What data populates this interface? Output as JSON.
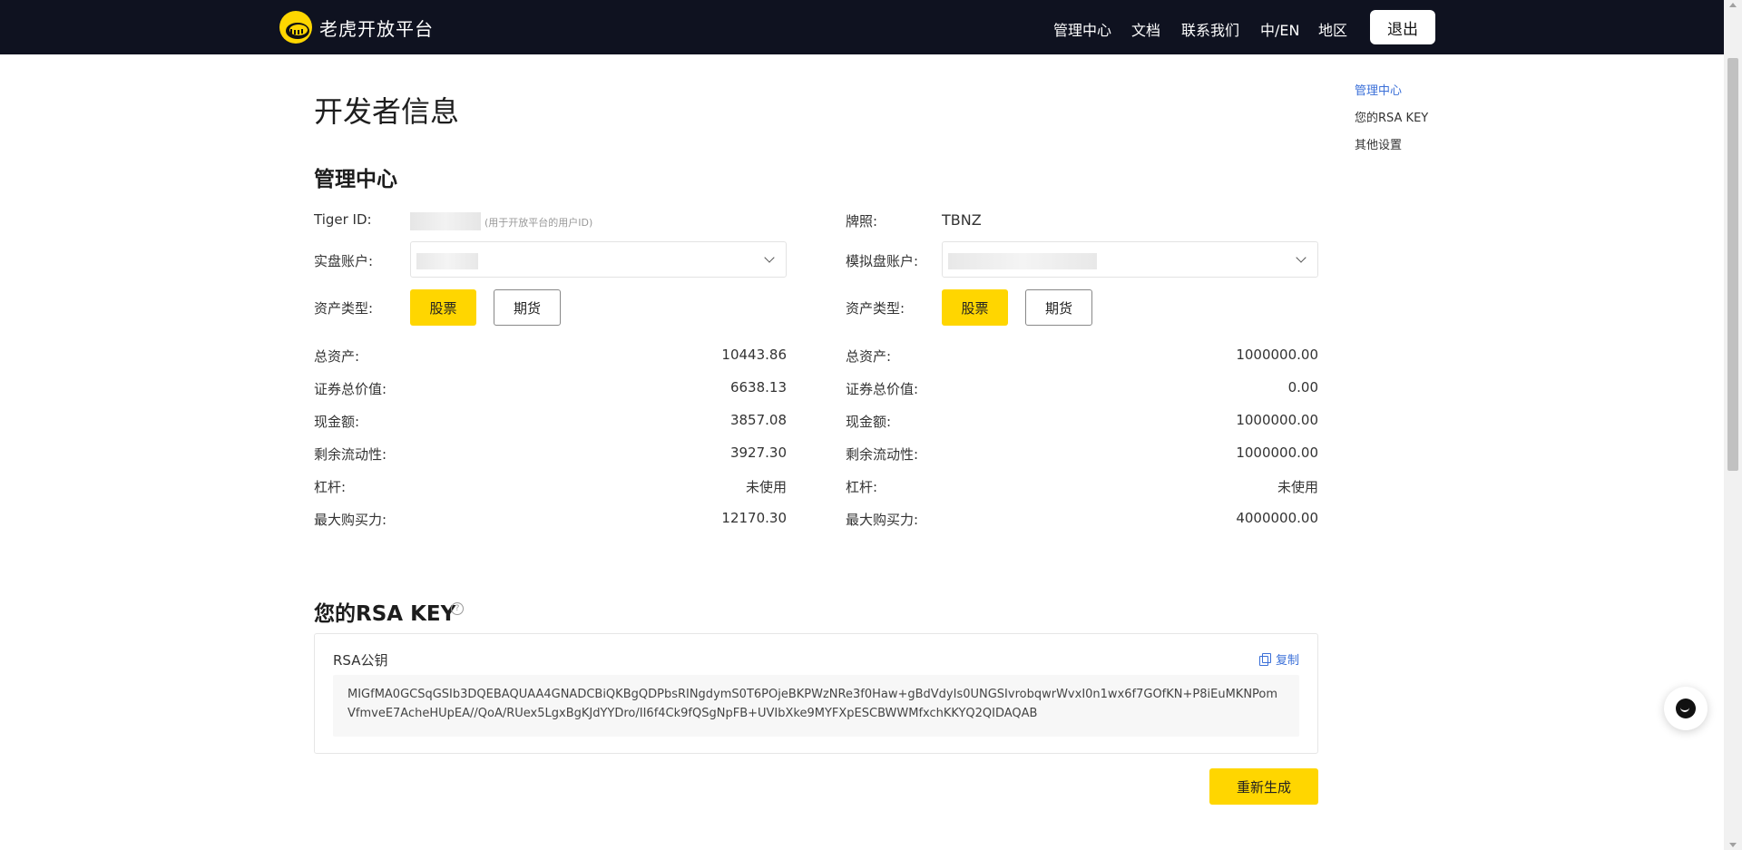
{
  "brand": {
    "name": "老虎开放平台",
    "color": "#ffd600"
  },
  "nav": {
    "items": [
      "管理中心",
      "文档",
      "联系我们",
      "中/EN",
      "地区"
    ],
    "logout": "退出"
  },
  "page": {
    "title": "开发者信息",
    "section_title": "管理中心"
  },
  "left": {
    "tiger_id_label": "Tiger ID:",
    "tiger_id_hint": "(用于开放平台的用户ID)",
    "account_label": "实盘账户:",
    "asset_type_label": "资产类型:",
    "btn_stock": "股票",
    "btn_futures": "期货",
    "rows": [
      {
        "label": "总资产:",
        "value": "10443.86"
      },
      {
        "label": "证券总价值:",
        "value": "6638.13"
      },
      {
        "label": "现金额:",
        "value": "3857.08"
      },
      {
        "label": "剩余流动性:",
        "value": "3927.30"
      },
      {
        "label": "杠杆:",
        "value": "未使用"
      },
      {
        "label": "最大购买力:",
        "value": "12170.30"
      }
    ]
  },
  "right": {
    "license_label": "牌照:",
    "license_value": "TBNZ",
    "account_label": "模拟盘账户:",
    "asset_type_label": "资产类型:",
    "btn_stock": "股票",
    "btn_futures": "期货",
    "rows": [
      {
        "label": "总资产:",
        "value": "1000000.00"
      },
      {
        "label": "证券总价值:",
        "value": "0.00"
      },
      {
        "label": "现金额:",
        "value": "1000000.00"
      },
      {
        "label": "剩余流动性:",
        "value": "1000000.00"
      },
      {
        "label": "杠杆:",
        "value": "未使用"
      },
      {
        "label": "最大购买力:",
        "value": "4000000.00"
      }
    ]
  },
  "rsa": {
    "title": "您的RSA KEY",
    "card_label": "RSA公钥",
    "copy": "复制",
    "key": "MIGfMA0GCSqGSIb3DQEBAQUAA4GNADCBiQKBgQDPbsRINgdymS0T6POjeBKPWzNRe3f0Haw+gBdVdyIs0UNGSIvrobqwrWvxI0n1wx6f7GOfKN+P8iEuMKNPomVfmveE7AcheHUpEA//QoA/RUex5LgxBgKJdYYDro/II6f4Ck9fQSgNpFB+UVIbXke9MYFXpESCBWWMfxchKKYQ2QIDAQAB",
    "regenerate": "重新生成"
  },
  "anchors": [
    "管理中心",
    "您的RSA KEY",
    "其他设置"
  ],
  "colors": {
    "accent_link": "#3a6fd8",
    "topbar": "#0f1220"
  }
}
